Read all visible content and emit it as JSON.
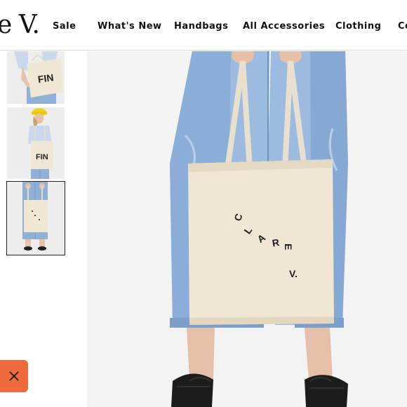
{
  "brand": {
    "logo_text": "e V."
  },
  "nav": {
    "items": [
      {
        "label": "Sale"
      },
      {
        "label": "What's New"
      },
      {
        "label": "Handbags"
      },
      {
        "label": "All Accessories"
      },
      {
        "label": "Clothing"
      },
      {
        "label": "Co"
      }
    ]
  },
  "thumbnails": [
    {
      "tote_text": "FIN",
      "selected": false
    },
    {
      "tote_text": "FIN",
      "selected": false
    },
    {
      "tote_text": "",
      "selected": true
    }
  ],
  "main_image": {
    "tote_letters": [
      "C",
      "L",
      "A",
      "R",
      "E",
      "V."
    ]
  },
  "colors": {
    "accent": "#ef6b3c",
    "tote": "#efe6d4",
    "denim": "#8fb1d6",
    "background": "#f3f3f3",
    "text": "#111111"
  },
  "icons": {
    "close": "close-icon"
  }
}
